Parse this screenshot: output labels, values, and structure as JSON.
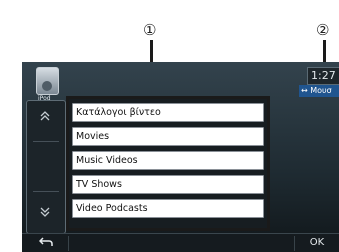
{
  "callouts": {
    "first": "①",
    "second": "②"
  },
  "header": {
    "source_label": "iPod",
    "time_text": "1:27",
    "music_tag": "↔ Μουσ"
  },
  "scroll": {
    "up_icon": "chevron-up",
    "down_icon": "chevron-down"
  },
  "list": {
    "items": [
      "Κατάλογοι βίντεο",
      "Movies",
      "Music Videos",
      "TV Shows",
      "Video Podcasts"
    ]
  },
  "footer": {
    "back_icon": "back-arrow",
    "ok_label": "OK"
  },
  "colors": {
    "screen_bg": "#1e2a31",
    "list_item_bg": "#ffffff",
    "tag_blue": "#20558f",
    "frame_black": "#1a1a1a"
  }
}
